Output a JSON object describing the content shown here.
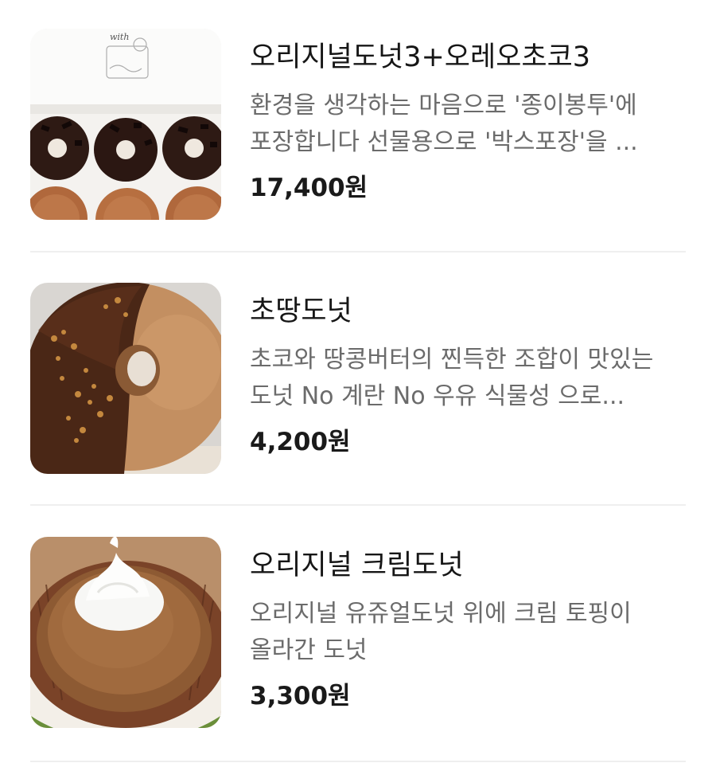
{
  "menu": {
    "items": [
      {
        "title": "오리지널도넛3+오레오초코3",
        "description": "환경을 생각하는 마음으로 '종이봉투'에 포장합니다 선물용으로 '박스포장'을 ...",
        "price": "17,400원",
        "image_icon": "donut-box-photo",
        "image_text": "with"
      },
      {
        "title": "초땅도넛",
        "description": "초코와 땅콩버터의 찐득한 조합이 맛있는 도넛 No 계란 No 우유 식물성 으로...",
        "price": "4,200원",
        "image_icon": "choco-peanut-donut-photo"
      },
      {
        "title": "오리지널 크림도넛",
        "description": "오리지널 유쥬얼도넛 위에 크림 토핑이 올라간 도넛",
        "price": "3,300원",
        "image_icon": "cream-donut-photo"
      }
    ]
  },
  "colors": {
    "title": "#161616",
    "description": "#6b6b6b",
    "price": "#1a1a1a",
    "divider": "#efefef"
  }
}
